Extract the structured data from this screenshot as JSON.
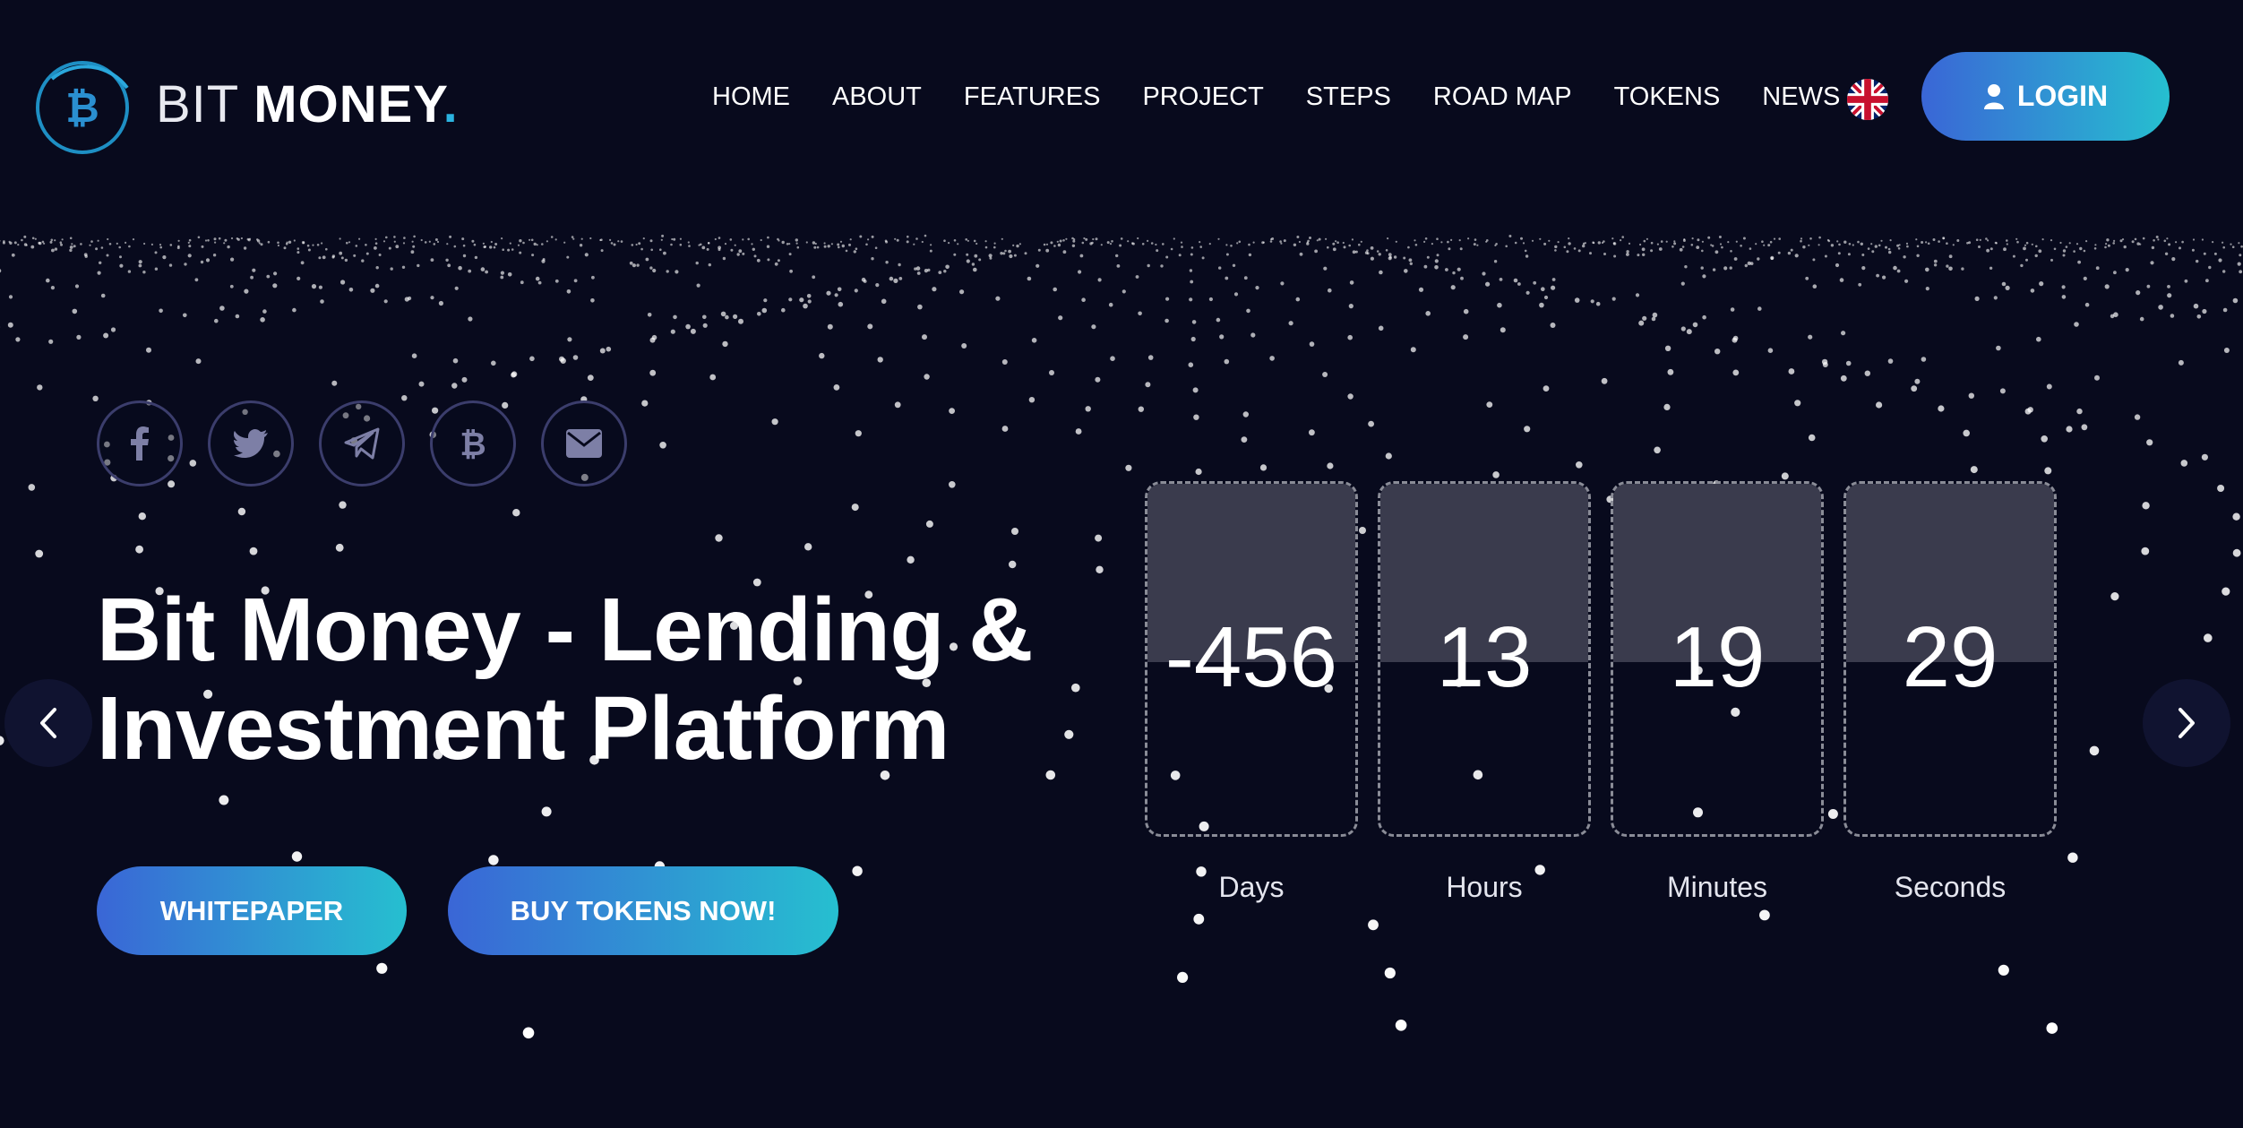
{
  "brand": {
    "name_part1": "BIT ",
    "name_part2": "MONEY",
    "name_dot": "."
  },
  "nav": {
    "items": [
      "HOME",
      "ABOUT",
      "FEATURES",
      "PROJECT",
      "STEPS",
      "ROAD MAP",
      "TOKENS",
      "NEWS"
    ],
    "language_flag": "uk-flag-icon",
    "login_label": "LOGIN"
  },
  "social": [
    "facebook-icon",
    "twitter-icon",
    "telegram-icon",
    "bitcoin-icon",
    "envelope-icon"
  ],
  "hero": {
    "title_line1": "Bit Money - Lending &",
    "title_line2": "Investment Platform",
    "whitepaper_label": "WHITEPAPER",
    "buy_label": "BUY TOKENS NOW!"
  },
  "countdown": [
    {
      "value": "-456",
      "label": "Days"
    },
    {
      "value": "13",
      "label": "Hours"
    },
    {
      "value": "19",
      "label": "Minutes"
    },
    {
      "value": "29",
      "label": "Seconds"
    }
  ],
  "colors": {
    "background": "#080a1d",
    "accent_start": "#3a66d6",
    "accent_end": "#26bfd0",
    "social_border": "#3b3d6c"
  }
}
